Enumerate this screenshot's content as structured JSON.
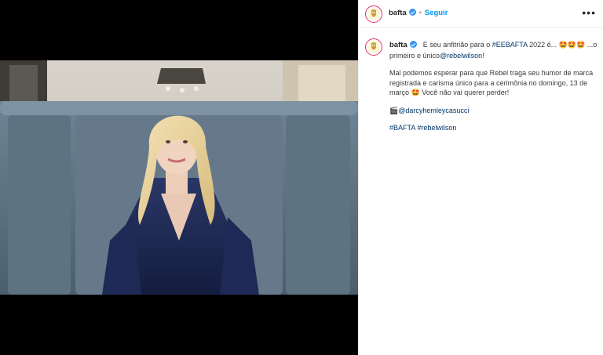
{
  "post": {
    "username": "bafta",
    "follow_label": "Seguir",
    "separator": "•",
    "more_label": "•••"
  },
  "caption": {
    "username": "bafta",
    "line1_text": "E seu anfitrião para o ",
    "line1_hashtag": "#EEBAFTA",
    "line1_rest": " 2022 é... 🤩🤩🤩 ...o primeiro e único",
    "line1_mention": "@rebelwilson",
    "line1_end": "!",
    "para2": "Mal podemos esperar para que Rebel traga seu humor de marca registrada e carisma único para a cerimônia no domingo, 13 de março 🤩 Você não vai querer perder!",
    "credit_icon": "🎬",
    "credit_mention": "@darcyhemleycasucci",
    "hashtag1": "#BAFTA",
    "hashtag2": "#rebelwilson"
  },
  "icons": {
    "avatar": "bafta-mask-icon",
    "verified": "verified-badge-icon",
    "more": "more-options-icon"
  },
  "colors": {
    "accent": "#0095f6",
    "link": "#00376b",
    "verified": "#3897f0",
    "avatar_ring": "#e1306c"
  }
}
